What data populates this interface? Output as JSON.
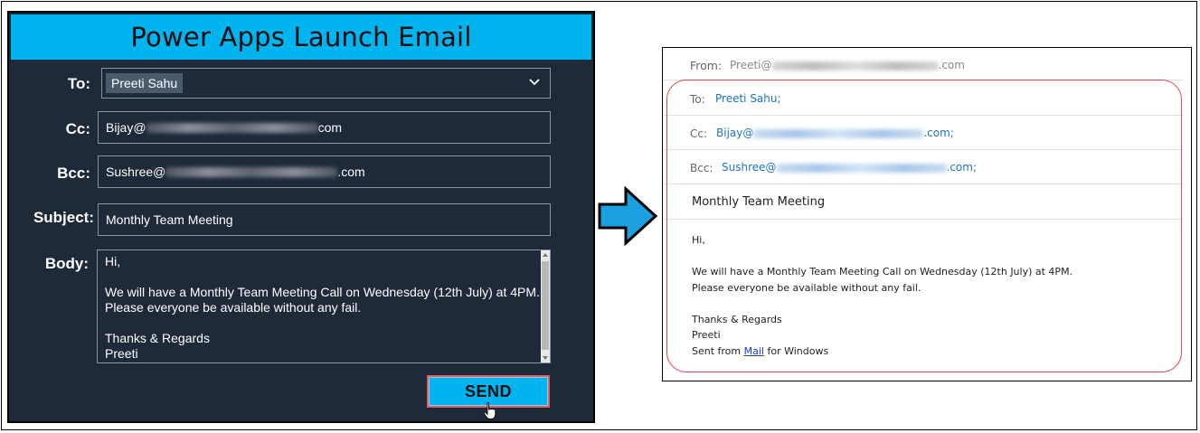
{
  "app": {
    "title": "Power Apps Launch Email",
    "to_label": "To:",
    "to_value": "Preeti Sahu",
    "cc_label": "Cc:",
    "cc_prefix": "Bijay@",
    "cc_suffix": "com",
    "bcc_label": "Bcc:",
    "bcc_prefix": "Sushree@",
    "bcc_suffix": ".com",
    "subject_label": "Subject:",
    "subject_value": "Monthly Team Meeting",
    "body_label": "Body:",
    "body_lines": [
      "Hi,",
      "",
      "We will have a Monthly Team Meeting Call on Wednesday (12th July) at 4PM.",
      "Please everyone be available without any fail.",
      "",
      "Thanks & Regards",
      "Preeti"
    ],
    "send_label": "SEND"
  },
  "mail": {
    "from_label": "From:",
    "from_prefix": "Preeti@",
    "from_suffix": ".com",
    "to_label": "To:",
    "to_value": "Preeti Sahu;",
    "cc_label": "Cc:",
    "cc_prefix": "Bijay@",
    "cc_suffix": ".com;",
    "bcc_label": "Bcc:",
    "bcc_prefix": "Sushree@",
    "bcc_suffix": ".com;",
    "subject": "Monthly Team Meeting",
    "body": {
      "greeting": "Hi,",
      "line1": "We will have a Monthly Team Meeting Call on Wednesday (12th July) at 4PM.",
      "line2": "Please everyone be available without any fail.",
      "closing": "Thanks & Regards",
      "name": "Preeti",
      "sent_prefix": "Sent from ",
      "sent_link": "Mail",
      "sent_suffix": " for Windows"
    }
  },
  "colors": {
    "accent": "#00b4ef",
    "panel_bg": "#1e2a3a",
    "highlight": "#e0434b",
    "link": "#1a73c6"
  },
  "icons": [
    "chevron-down-icon",
    "hand-pointer-icon",
    "right-arrow-icon"
  ]
}
